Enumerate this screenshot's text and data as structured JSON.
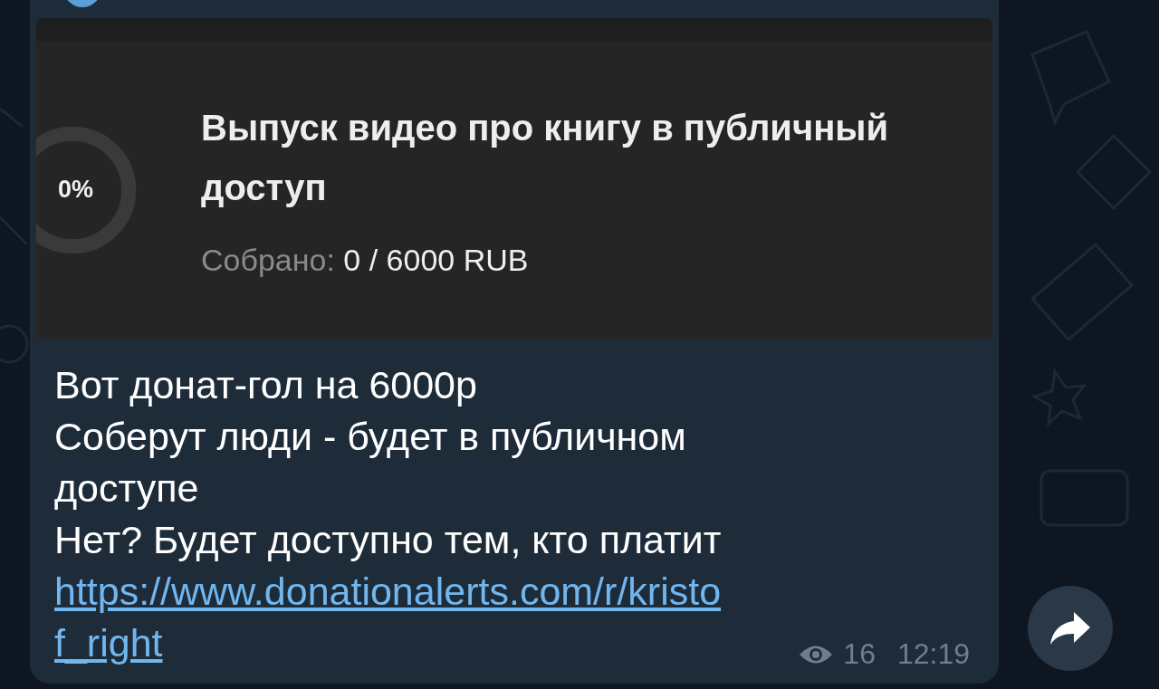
{
  "donation_goal": {
    "percent": "0%",
    "level": 0,
    "title": "Выпуск видео про книгу в публичный доступ",
    "collected_label": "Собрано:",
    "collected_value": "0 / 6000 RUB"
  },
  "message": {
    "lines": [
      "Вот донат-гол на 6000р",
      "Соберут люди - будет в публичном доступе",
      "Нет? Будет доступно тем, кто платит"
    ],
    "link": "https://www.donationalerts.com/r/kristof_right",
    "views": "16",
    "time": "12:19"
  }
}
